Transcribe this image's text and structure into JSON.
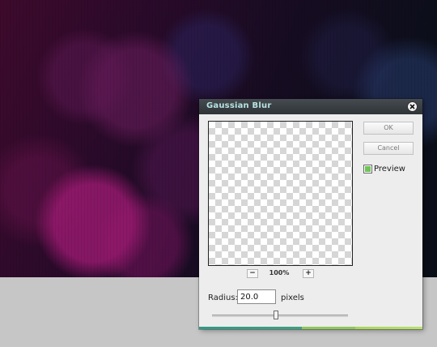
{
  "dialog": {
    "title": "Gaussian Blur",
    "ok_label": "OK",
    "cancel_label": "Cancel",
    "preview_label": "Preview",
    "preview_checked": true,
    "zoom": {
      "out_label": "−",
      "in_label": "+",
      "level": "100%"
    },
    "radius": {
      "label": "Radius:",
      "value": "20.0",
      "units": "pixels",
      "slider_fraction": 0.47
    }
  },
  "colors": {
    "title_text": "#b7e3e1",
    "titlebar": "#3a3f44",
    "dialog_bg": "#ededed",
    "preview_checkbox": "#6fc35a",
    "accent_teal": "#2f9a86",
    "accent_green": "#8cc85a"
  },
  "icons": {
    "close": "close-x-icon"
  }
}
